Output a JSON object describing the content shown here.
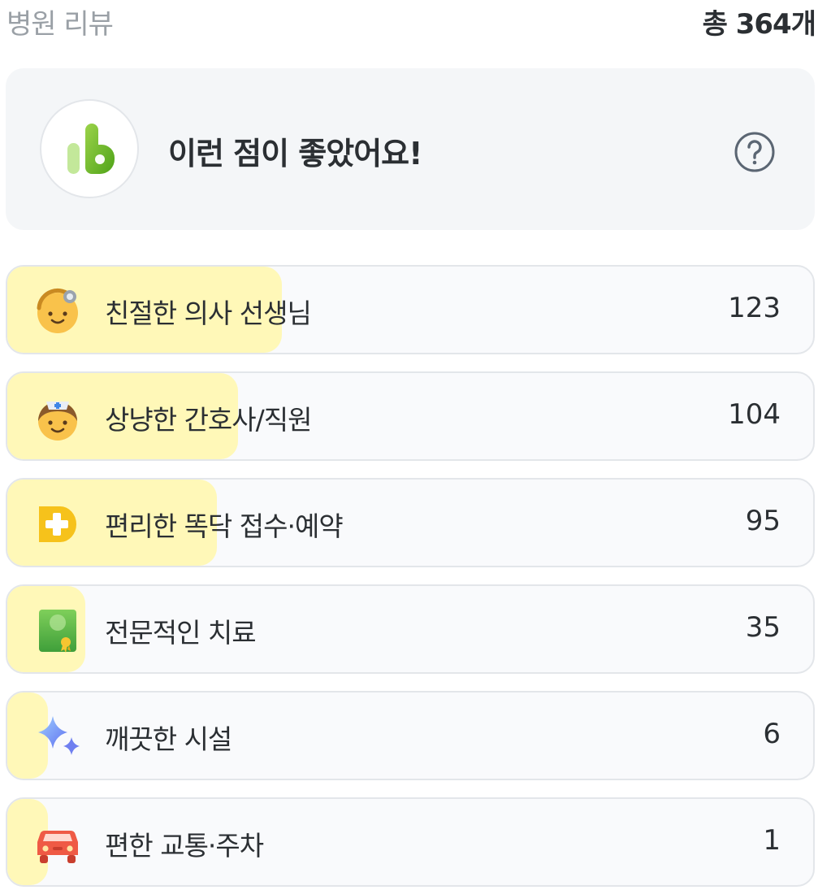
{
  "header": {
    "title": "병원 리뷰",
    "total": "총 364개"
  },
  "banner": {
    "icon": "thumbs-up-icon",
    "title": "이런 점이 좋았어요!",
    "help_icon": "question-circle-icon"
  },
  "colors": {
    "fill": "#fff8b8",
    "card": "#f9fafc",
    "border": "#e3e6ea",
    "text": "#2b2f33",
    "muted": "#9aa0a6"
  },
  "items": [
    {
      "icon": "doctor-face-icon",
      "label": "친절한 의사 선생님",
      "count": "123"
    },
    {
      "icon": "nurse-face-icon",
      "label": "상냥한 간호사/직원",
      "count": "104"
    },
    {
      "icon": "plus-app-icon",
      "label": "편리한 똑닥 접수·예약",
      "count": "95"
    },
    {
      "icon": "certificate-icon",
      "label": "전문적인 치료",
      "count": "35"
    },
    {
      "icon": "sparkles-icon",
      "label": "깨끗한 시설",
      "count": "6"
    },
    {
      "icon": "car-icon",
      "label": "편한 교통·주차",
      "count": "1"
    }
  ]
}
